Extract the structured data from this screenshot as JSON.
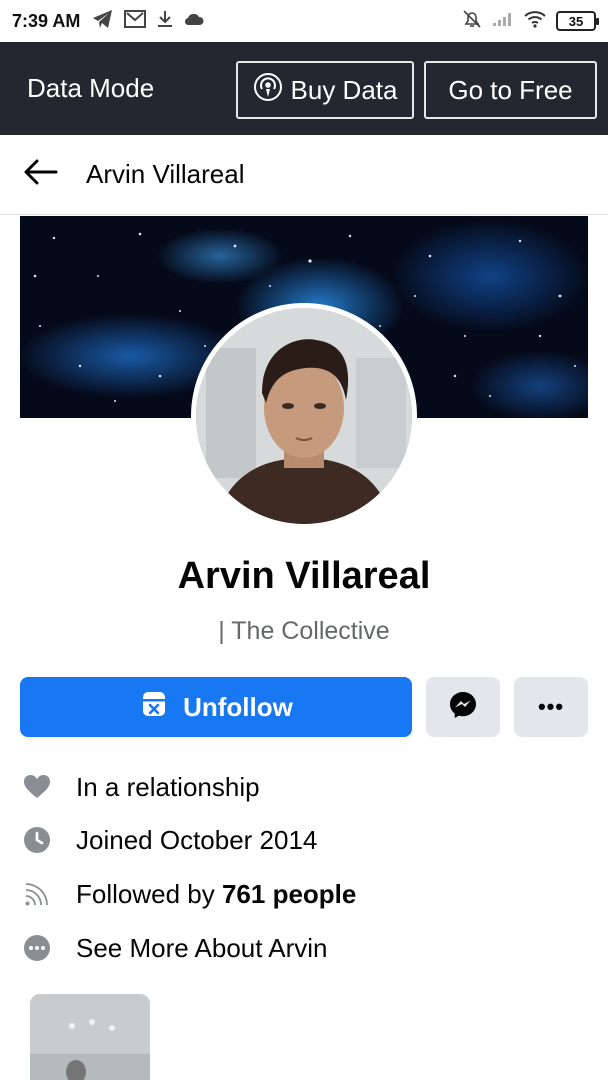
{
  "status_bar": {
    "time": "7:39 AM",
    "battery": "35",
    "left_icons": [
      "telegram-icon",
      "gmail-icon",
      "download-icon",
      "cloud-icon"
    ],
    "right_icons": [
      "mute-bell-icon",
      "signal-icon",
      "wifi-icon"
    ]
  },
  "data_bar": {
    "label": "Data Mode",
    "buy_data_label": "Buy Data",
    "go_free_label": "Go to Free"
  },
  "header": {
    "title": "Arvin Villareal"
  },
  "profile": {
    "name": "Arvin Villareal",
    "subtitle": "| The Collective"
  },
  "actions": {
    "unfollow_label": "Unfollow",
    "more_label": "•••"
  },
  "info": {
    "relationship": "In a relationship",
    "joined": "Joined October 2014",
    "followed_prefix": "Followed by ",
    "followed_count": "761 people",
    "see_more": "See More About Arvin"
  },
  "colors": {
    "accent": "#1877f2",
    "data_bar_bg": "#23272f",
    "secondary_button": "#e4e6eb",
    "icon_gray": "#8a8d91"
  }
}
